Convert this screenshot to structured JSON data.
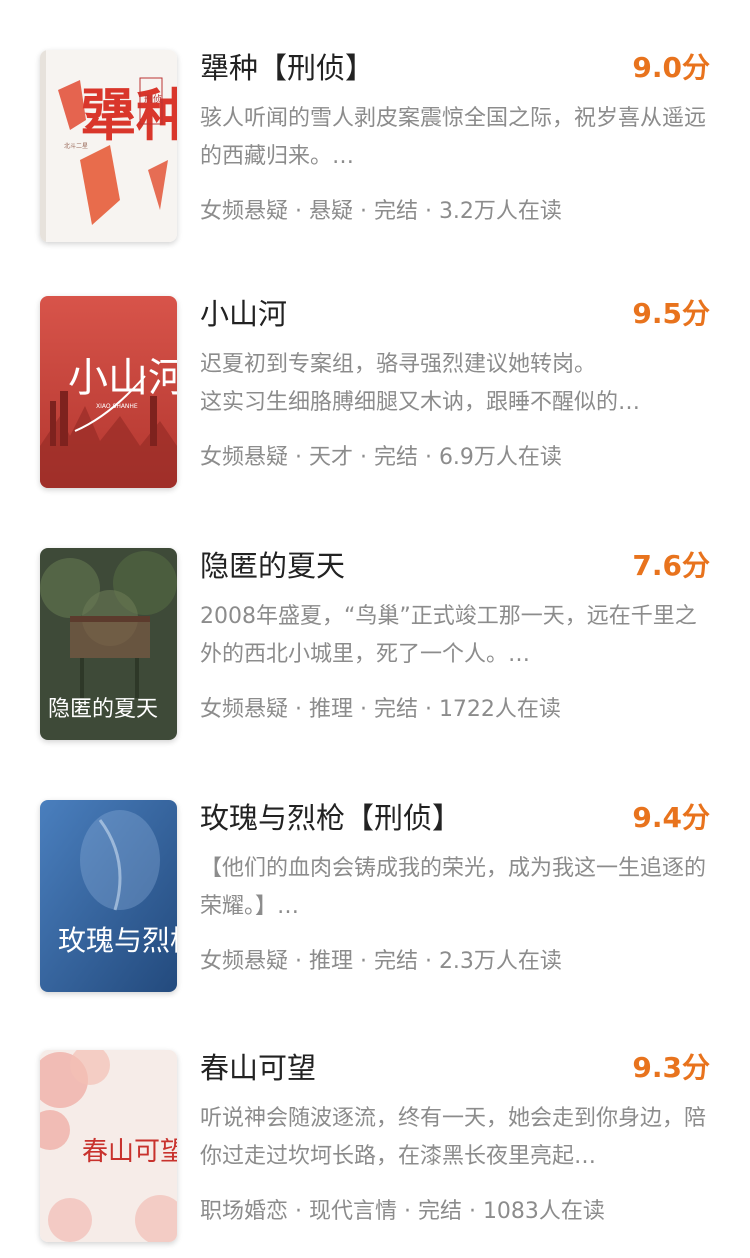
{
  "books": [
    {
      "title": "犟种【刑侦】",
      "score": "9.0分",
      "description": "骇人听闻的雪人剥皮案震惊全国之际，祝岁喜从遥远的西藏归来。…",
      "meta": "女频悬疑 · 悬疑 · 完结 · 3.2万人在读",
      "cover": {
        "title_art": "犟种",
        "label": "刑侦",
        "author": "北斗二星",
        "bg": "#f7f4f1",
        "accent": "#d9362b"
      }
    },
    {
      "title": "小山河",
      "score": "9.5分",
      "description": "迟夏初到专案组，骆寻强烈建议她转岗。\n这实习生细胳膊细腿又木讷，跟睡不醒似的…",
      "meta": "女频悬疑 · 天才 · 完结 · 6.9万人在读",
      "cover": {
        "title_art": "小山河",
        "pinyin": "XIAO SHANHE",
        "bg": "#c9453c",
        "accent": "#ffffff"
      }
    },
    {
      "title": "隐匿的夏天",
      "score": "7.6分",
      "description": "2008年盛夏，“鸟巢”正式竣工那一天，远在千里之外的西北小城里，死了一个人。…",
      "meta": "女频悬疑 · 推理 · 完结 · 1722人在读",
      "cover": {
        "title_art": "隐匿的夏天",
        "bg": "#3e4a38",
        "accent": "#ffffff"
      }
    },
    {
      "title": "玫瑰与烈枪【刑侦】",
      "score": "9.4分",
      "description": "【他们的血肉会铸成我的荣光，成为我这一生追逐的荣耀。】…",
      "meta": "女频悬疑 · 推理 · 完结 · 2.3万人在读",
      "cover": {
        "title_art": "玫瑰与烈枪",
        "bg": "#2f5d9a",
        "accent": "#ffffff"
      }
    },
    {
      "title": "春山可望",
      "score": "9.3分",
      "description": "听说神会随波逐流，终有一天，她会走到你身边，陪你过走过坎坷长路，在漆黑长夜里亮起…",
      "meta": "职场婚恋 · 现代言情 · 完结 · 1083人在读",
      "cover": {
        "title_art": "春山可望",
        "bg": "#f6ece8",
        "accent": "#c8322d"
      }
    }
  ],
  "colors": {
    "score": "#e8731d",
    "title": "#222222",
    "muted": "#8c8c8c",
    "background": "#ffffff"
  }
}
